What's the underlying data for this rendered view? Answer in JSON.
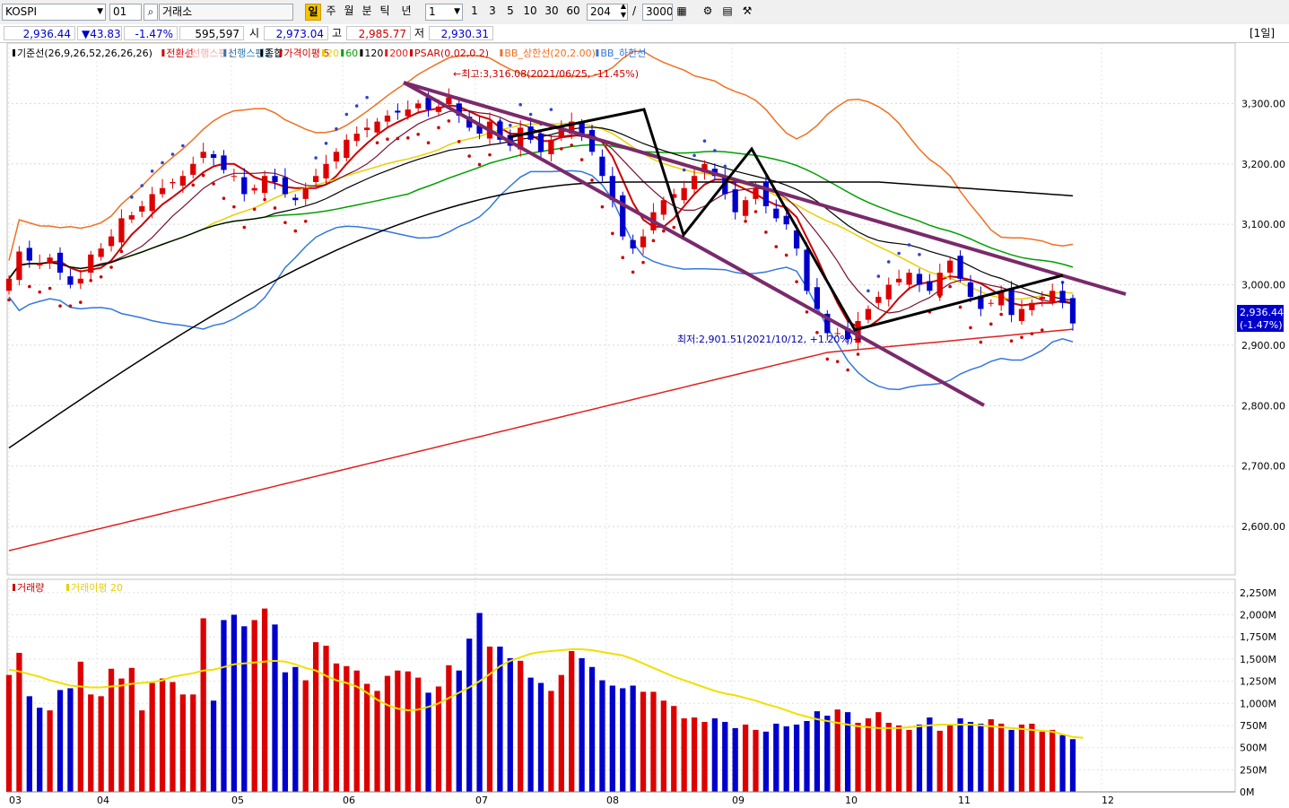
{
  "toolbar": {
    "symbol": "KOSPI",
    "code": "01",
    "market": "거래소",
    "periods": [
      "일",
      "주",
      "월",
      "분",
      "틱",
      "년"
    ],
    "active_period": "일",
    "interval": "1",
    "minutes": [
      "1",
      "3",
      "5",
      "10",
      "30",
      "60"
    ],
    "count": "204",
    "separator": "/",
    "max_count": "3000"
  },
  "quote": {
    "last": "2,936.44",
    "change": "▼43.83",
    "change_pct": "-1.47%",
    "volume": "595,597",
    "open_label": "시",
    "open": "2,973.04",
    "high_label": "고",
    "high": "2,985.77",
    "low_label": "저",
    "low": "2,930.31",
    "period_badge": "[1일]"
  },
  "legend_price": [
    {
      "text": "기준선(26,9,26,52,26,26,26)",
      "color": "#000000"
    },
    {
      "text": "전환선",
      "color": "#cc0000"
    },
    {
      "text": "선행스팬1",
      "color": "#f4aab0"
    },
    {
      "text": "선행스팬2",
      "color": "#2a7ab8"
    },
    {
      "text": "종합",
      "color": "#000000"
    },
    {
      "text": "가격이평 5",
      "color": "#cc0000"
    },
    {
      "text": "20",
      "color": "#e8d000"
    },
    {
      "text": "60",
      "color": "#00a000"
    },
    {
      "text": "120",
      "color": "#000000"
    },
    {
      "text": "200",
      "color": "#e02020"
    },
    {
      "text": "PSAR(0.02,0.2)",
      "color": "#cc0000"
    },
    {
      "text": "BB_상한선(20,2.00)",
      "color": "#f07020"
    },
    {
      "text": "BB_하한선",
      "color": "#3377dd"
    }
  ],
  "legend_volume": [
    {
      "text": "거래량",
      "color": "#cc0000"
    },
    {
      "text": "거래이평 20",
      "color": "#e8d000"
    }
  ],
  "annotations": {
    "high": "←최고:3,316.08(2021/06/25, -11.45%)",
    "low": "최저:2,901.51(2021/10/12, +1.20%)→",
    "price_tag": "2,936.44",
    "price_tag_pct": "(-1.47%)"
  },
  "colors": {
    "up": "#dd0000",
    "down": "#0000cc",
    "channel": "#7a2a6a",
    "pattern": "#000000"
  },
  "chart_data": {
    "type": "candlestick",
    "price_axis": {
      "ticks": [
        "3,300.00",
        "3,200.00",
        "3,100.00",
        "3,000.00",
        "2,900.00",
        "2,800.00",
        "2,700.00",
        "2,600.00"
      ],
      "ylim": [
        2520,
        3400
      ]
    },
    "volume_axis": {
      "ticks": [
        "2,250M",
        "2,000M",
        "1,750M",
        "1,500M",
        "1,250M",
        "1,000M",
        "750M",
        "500M",
        "250M",
        "0M"
      ],
      "ylim": [
        0,
        2400
      ]
    },
    "months": [
      "03",
      "04",
      "05",
      "06",
      "07",
      "08",
      "09",
      "10",
      "11",
      "12"
    ],
    "price_series": [
      {
        "name": "close",
        "color": "#000000",
        "values": [
          3010,
          3055,
          3040,
          3035,
          3045,
          3020,
          3000,
          3010,
          3050,
          3060,
          3080,
          3110,
          3115,
          3130,
          3150,
          3160,
          3170,
          3180,
          3200,
          3220,
          3210,
          3190,
          3180,
          3150,
          3160,
          3180,
          3170,
          3150,
          3140,
          3160,
          3180,
          3200,
          3220,
          3240,
          3250,
          3260,
          3270,
          3280,
          3285,
          3290,
          3300,
          3290,
          3295,
          3310,
          3280,
          3260,
          3250,
          3270,
          3240,
          3230,
          3260,
          3240,
          3220,
          3240,
          3260,
          3270,
          3250,
          3220,
          3180,
          3140,
          3080,
          3060,
          3080,
          3120,
          3140,
          3150,
          3160,
          3180,
          3200,
          3180,
          3150,
          3120,
          3140,
          3160,
          3130,
          3110,
          3100,
          3060,
          2990,
          2960,
          2920,
          2920,
          2910,
          2940,
          2960,
          2980,
          3000,
          3010,
          3020,
          3000,
          2990,
          3020,
          3040,
          3010,
          2980,
          2960,
          2970,
          2990,
          2950,
          2960,
          2970,
          2980,
          2990,
          2970,
          2936
        ]
      }
    ],
    "volume_series": {
      "name": "거래량",
      "values": [
        1320,
        1570,
        1080,
        950,
        920,
        1150,
        1170,
        1470,
        1100,
        1080,
        1390,
        1280,
        1400,
        920,
        1230,
        1280,
        1240,
        1100,
        1100,
        1960,
        1030,
        1940,
        2000,
        1870,
        1940,
        2070,
        1890,
        1350,
        1410,
        1260,
        1690,
        1650,
        1450,
        1420,
        1370,
        1220,
        1140,
        1310,
        1370,
        1360,
        1290,
        1120,
        1190,
        1430,
        1370,
        1730,
        2020,
        1640,
        1640,
        1510,
        1480,
        1290,
        1230,
        1140,
        1320,
        1590,
        1510,
        1410,
        1260,
        1200,
        1170,
        1200,
        1130,
        1130,
        1030,
        970,
        830,
        840,
        790,
        830,
        790,
        720,
        760,
        700,
        680,
        770,
        740,
        760,
        800,
        910,
        860,
        930,
        900,
        780,
        830,
        900,
        780,
        750,
        700,
        760,
        840,
        690,
        760,
        830,
        790,
        770,
        820,
        770,
        700,
        760,
        770,
        680,
        700,
        640,
        595
      ]
    },
    "volume_ma20": {
      "name": "거래이평 20",
      "values": [
        1380,
        1360,
        1330,
        1300,
        1260,
        1230,
        1200,
        1190,
        1180,
        1180,
        1190,
        1200,
        1220,
        1230,
        1240,
        1260,
        1300,
        1320,
        1340,
        1370,
        1380,
        1410,
        1440,
        1450,
        1460,
        1470,
        1480,
        1470,
        1440,
        1400,
        1370,
        1310,
        1260,
        1230,
        1190,
        1120,
        1040,
        980,
        940,
        920,
        930,
        960,
        1000,
        1060,
        1120,
        1180,
        1250,
        1330,
        1420,
        1480,
        1520,
        1560,
        1580,
        1590,
        1600,
        1610,
        1610,
        1600,
        1580,
        1560,
        1540,
        1500,
        1450,
        1400,
        1350,
        1300,
        1260,
        1220,
        1180,
        1140,
        1110,
        1090,
        1060,
        1030,
        990,
        960,
        920,
        880,
        850,
        820,
        800,
        780,
        760,
        740,
        730,
        720,
        720,
        720,
        730,
        740,
        750,
        760,
        760,
        760,
        760,
        750,
        740,
        730,
        720,
        710,
        700,
        690,
        680,
        650,
        620,
        610
      ]
    }
  }
}
